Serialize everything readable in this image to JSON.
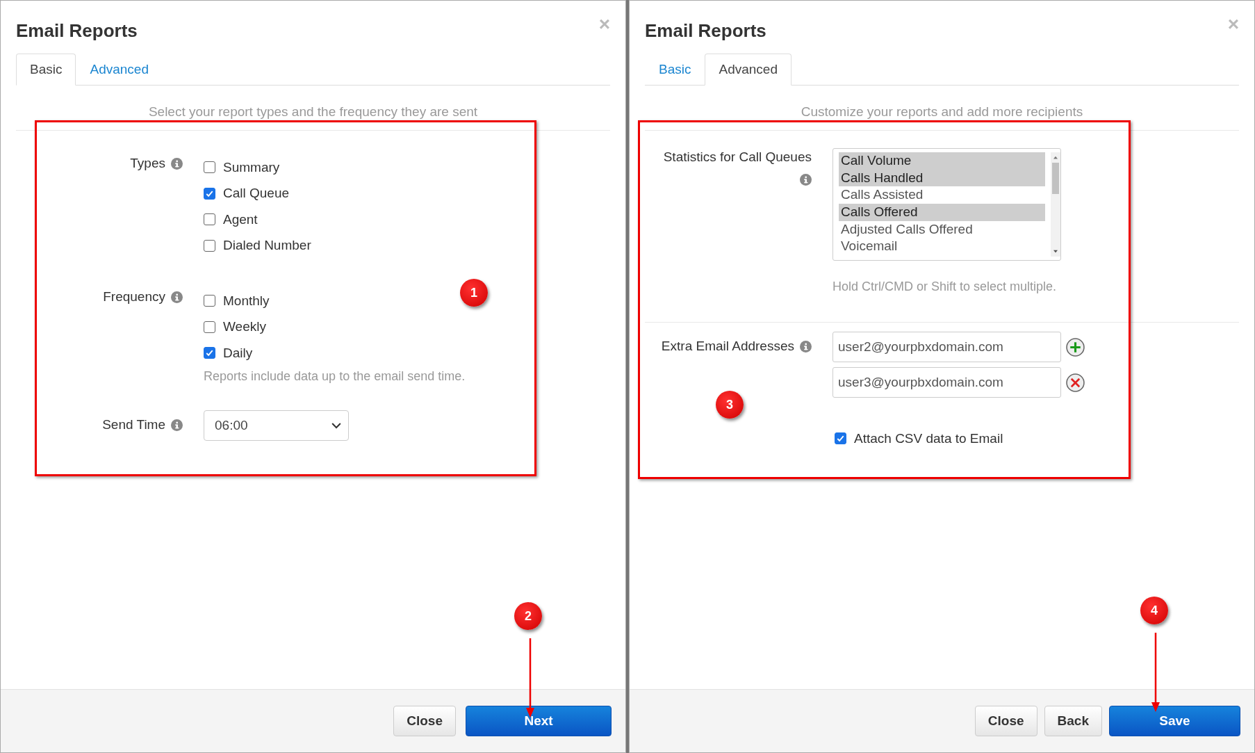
{
  "dialogs": [
    {
      "kind": "basic",
      "title": "Email Reports",
      "close_icon": "×",
      "tabs": [
        {
          "label": "Basic",
          "selected": true
        },
        {
          "label": "Advanced",
          "selected": false
        }
      ],
      "subtitle": "Select your report types and the frequency they are sent",
      "highlighted": true,
      "groups": [
        {
          "label": "Types",
          "options": [
            {
              "label": "Summary",
              "checked": false
            },
            {
              "label": "Call Queue",
              "checked": true
            },
            {
              "label": "Agent",
              "checked": false
            },
            {
              "label": "Dialed Number",
              "checked": false
            }
          ]
        },
        {
          "label": "Frequency",
          "options": [
            {
              "label": "Monthly",
              "checked": false
            },
            {
              "label": "Weekly",
              "checked": false
            },
            {
              "label": "Daily",
              "checked": true
            }
          ],
          "help": "Reports include data up to the email send time."
        }
      ],
      "send_time": {
        "label": "Send Time",
        "value": "06:00"
      },
      "annotations": [
        {
          "kind": "badge",
          "number": "1"
        },
        {
          "kind": "arrow",
          "number": "2"
        }
      ],
      "buttons": [
        {
          "label": "Close",
          "kind": "default"
        },
        {
          "label": "Next",
          "kind": "primary"
        }
      ]
    },
    {
      "kind": "advanced",
      "title": "Email Reports",
      "close_icon": "×",
      "tabs": [
        {
          "label": "Basic",
          "selected": false
        },
        {
          "label": "Advanced",
          "selected": true
        }
      ],
      "subtitle": "Customize your reports and add more recipients",
      "highlighted": true,
      "statistics": {
        "label": "Statistics for Call Queues",
        "options": [
          {
            "label": "Call Volume",
            "selected": true
          },
          {
            "label": "Calls Handled",
            "selected": true
          },
          {
            "label": "Calls Assisted",
            "selected": false
          },
          {
            "label": "Calls Offered",
            "selected": true
          },
          {
            "label": "Adjusted Calls Offered",
            "selected": false
          },
          {
            "label": "Voicemail",
            "selected": false
          }
        ],
        "help": "Hold Ctrl/CMD or Shift to select multiple."
      },
      "emails": {
        "label": "Extra Email Addresses",
        "fields": [
          {
            "value": "user2@yourpbxdomain.com",
            "kind": "add"
          },
          {
            "value": "user3@yourpbxdomain.com",
            "kind": "remove"
          }
        ]
      },
      "attach": {
        "label": "Attach CSV data to Email",
        "checked": true
      },
      "annotations": [
        {
          "kind": "badge",
          "number": "3"
        },
        {
          "kind": "arrow",
          "number": "4"
        }
      ],
      "buttons": [
        {
          "label": "Close",
          "kind": "default"
        },
        {
          "label": "Back",
          "kind": "default"
        },
        {
          "label": "Save",
          "kind": "primary"
        }
      ]
    }
  ]
}
